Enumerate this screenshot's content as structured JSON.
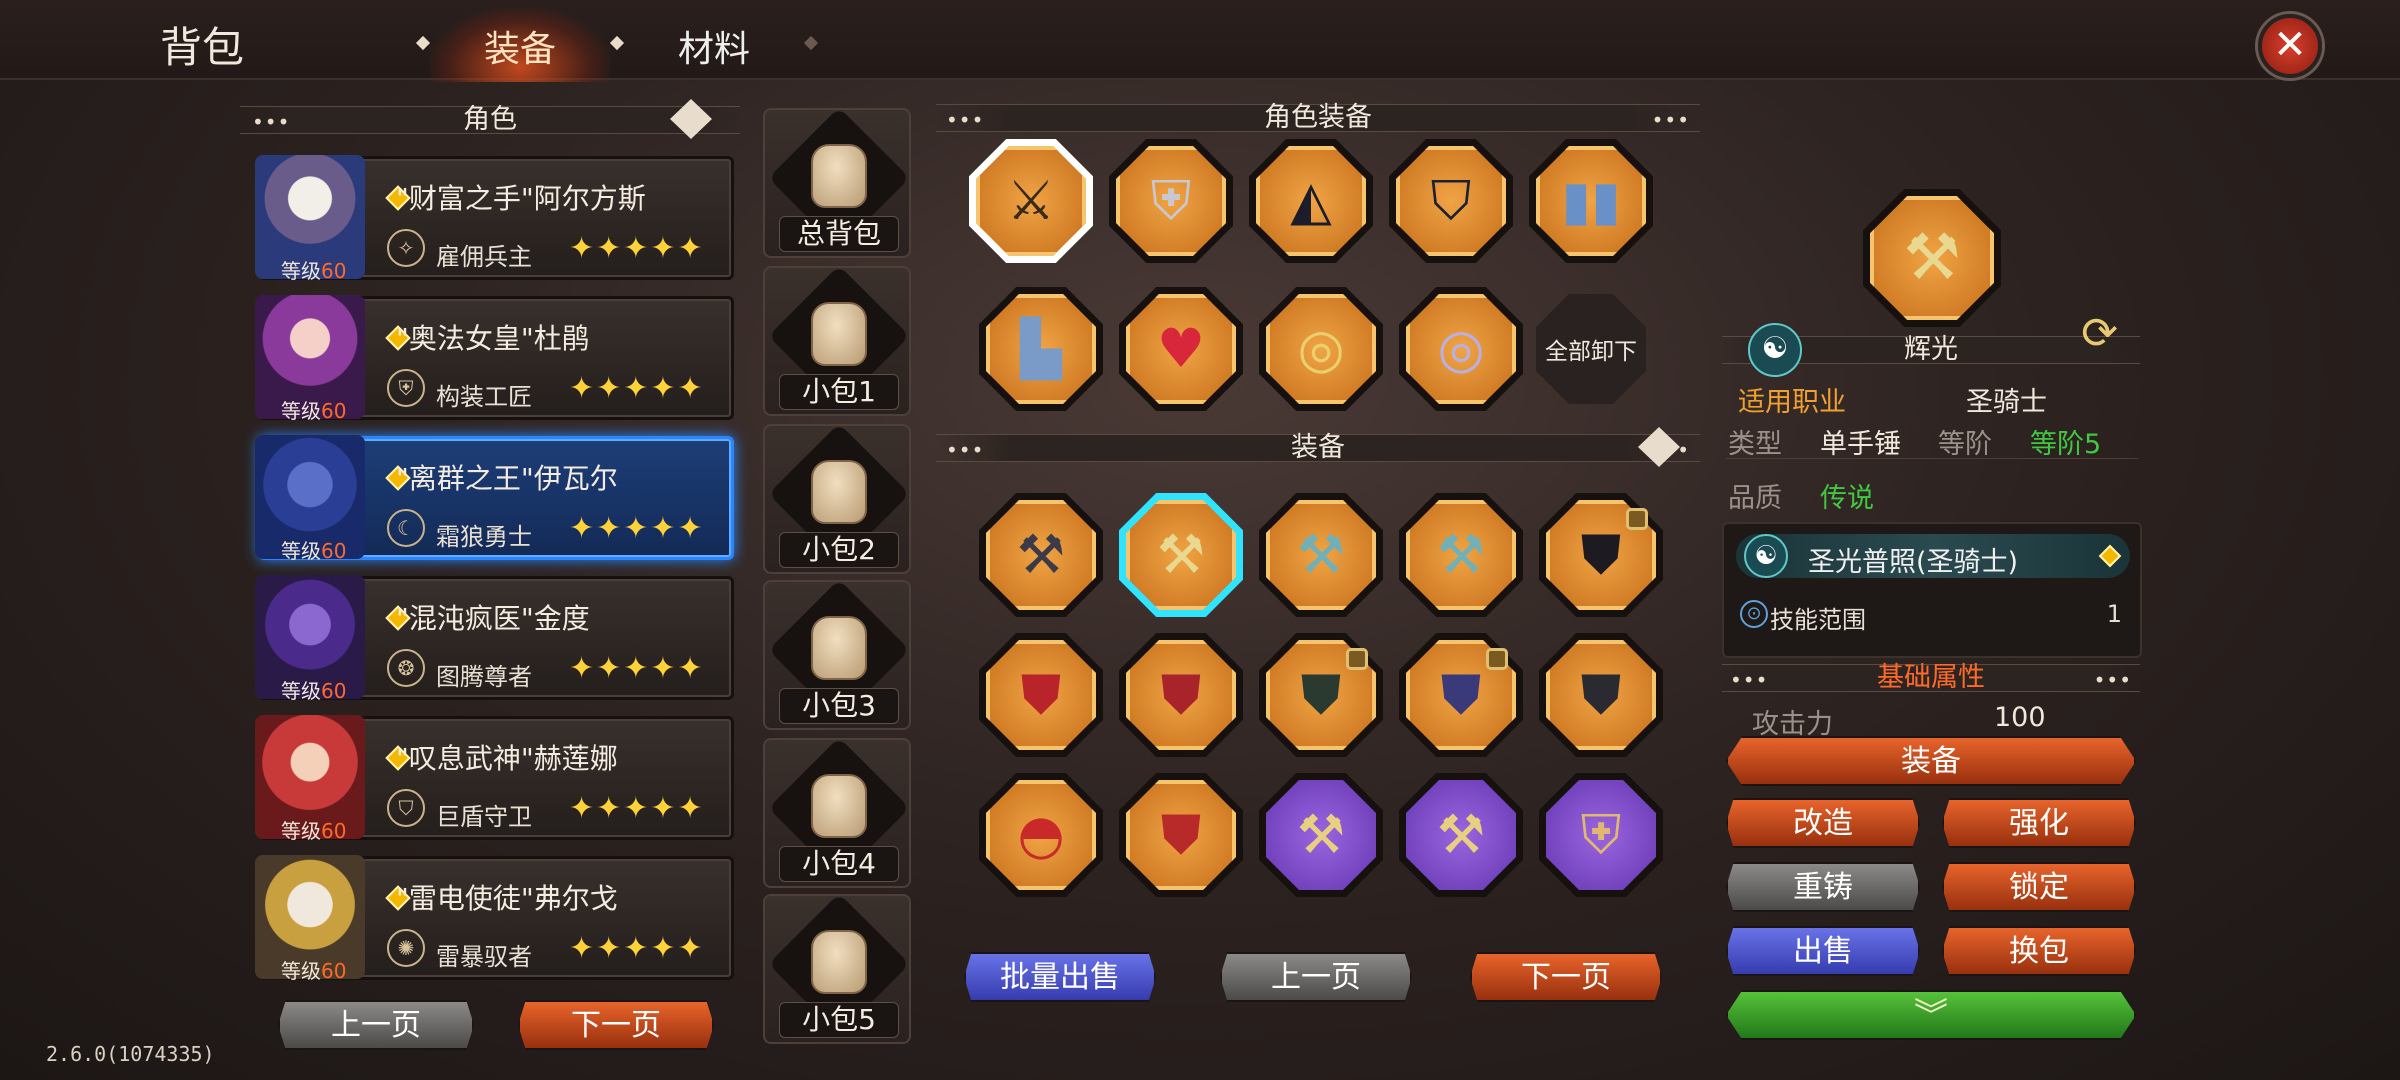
{
  "header": {
    "title": "背包",
    "tabs": [
      {
        "label": "装备",
        "active": true
      },
      {
        "label": "材料",
        "active": false
      }
    ],
    "close_icon": "close-icon"
  },
  "left": {
    "section_title": "角色",
    "characters": [
      {
        "name": "\"财富之手\"阿尔方斯",
        "class": "雇佣兵主",
        "stars": "✦✦✦✦✦",
        "level_label": "等级",
        "level": "60"
      },
      {
        "name": "\"奥法女皇\"杜鹃",
        "class": "构装工匠",
        "stars": "✦✦✦✦✦",
        "level_label": "等级",
        "level": "60"
      },
      {
        "name": "\"离群之王\"伊瓦尔",
        "class": "霜狼勇士",
        "stars": "✦✦✦✦✦",
        "level_label": "等级",
        "level": "60"
      },
      {
        "name": "\"混沌疯医\"金度",
        "class": "图腾尊者",
        "stars": "✦✦✦✦✦",
        "level_label": "等级",
        "level": "60"
      },
      {
        "name": "\"叹息武神\"赫莲娜",
        "class": "巨盾守卫",
        "stars": "✦✦✦✦✦",
        "level_label": "等级",
        "level": "60"
      },
      {
        "name": "\"雷电使徒\"弗尔戈",
        "class": "雷暴驭者",
        "stars": "✦✦✦✦✦",
        "level_label": "等级",
        "level": "60"
      }
    ],
    "prev": "上一页",
    "next": "下一页",
    "version": "2.6.0(1074335)"
  },
  "bags": [
    "总背包",
    "小包1",
    "小包2",
    "小包3",
    "小包4",
    "小包5"
  ],
  "role_equip": {
    "title": "角色装备",
    "unequip_all": "全部卸下"
  },
  "equip": {
    "title": "装备",
    "batch_sell": "批量出售",
    "prev": "上一页",
    "next": "下一页"
  },
  "detail": {
    "item_name": "辉光",
    "job_label": "适用职业",
    "job": "圣骑士",
    "type_label": "类型",
    "type": "单手锤",
    "tier_label": "等阶",
    "tier": "等阶5",
    "quality_label": "品质",
    "quality": "传说",
    "skill_title": "圣光普照(圣骑士)",
    "skill_attr": "技能范围",
    "skill_val": "1",
    "base_title": "基础属性",
    "atk_label": "攻击力",
    "atk": "100",
    "buttons": {
      "equip": "装备",
      "modify": "改造",
      "enhance": "强化",
      "recast": "重铸",
      "lock": "锁定",
      "sell": "出售",
      "swap": "换包"
    }
  },
  "colors": {
    "accent": "#ff6a2a",
    "legend": "#40c840",
    "job": "#f0a030"
  }
}
